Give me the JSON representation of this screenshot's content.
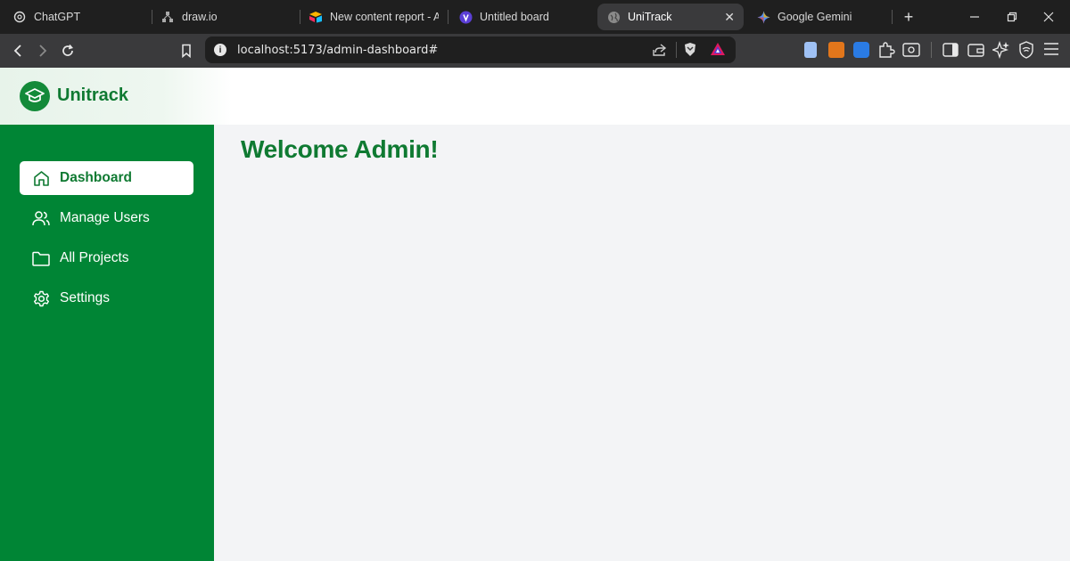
{
  "browser": {
    "tabs": [
      {
        "label": "ChatGPT",
        "icon": "openai-icon"
      },
      {
        "label": "draw.io",
        "icon": "drawio-icon"
      },
      {
        "label": "New content report - Air",
        "icon": "airtable-icon"
      },
      {
        "label": "Untitled board",
        "icon": "board-icon"
      },
      {
        "label": "UniTrack",
        "icon": "globe-icon",
        "active": true
      },
      {
        "label": "Google Gemini",
        "icon": "gemini-icon"
      }
    ],
    "new_tab": "+",
    "url": "localhost:5173/admin-dashboard#"
  },
  "app": {
    "brand": "Unitrack",
    "nav": [
      {
        "label": "Dashboard",
        "icon": "home-icon",
        "active": true
      },
      {
        "label": "Manage Users",
        "icon": "users-icon"
      },
      {
        "label": "All Projects",
        "icon": "folder-icon"
      },
      {
        "label": "Settings",
        "icon": "gear-icon"
      }
    ],
    "welcome": "Welcome Admin!"
  },
  "colors": {
    "brand_green": "#008535",
    "title_green": "#0f7a32",
    "main_bg": "#f3f4f6"
  }
}
